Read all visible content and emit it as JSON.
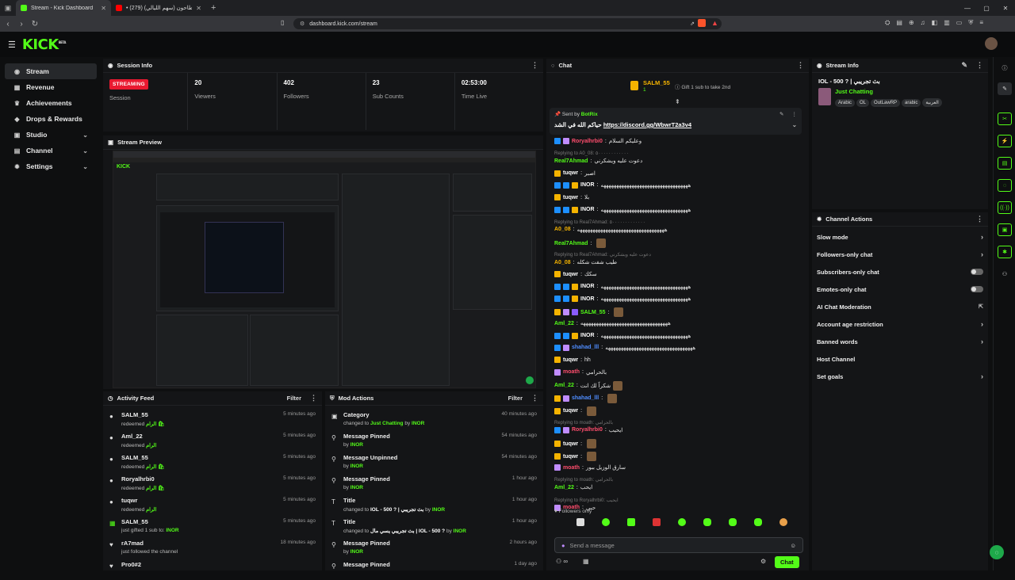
{
  "browser": {
    "tabs": [
      {
        "title": "Stream - Kick Dashboard",
        "favicon_color": "#53fc18"
      },
      {
        "title": "• كان عندنا طاحون (سهم الليالي) (279)",
        "favicon_color": "#ff0000"
      }
    ],
    "url": "dashboard.kick.com/stream"
  },
  "sidenav": [
    {
      "label": "Stream",
      "icon": "broadcast-icon",
      "active": true
    },
    {
      "label": "Revenue",
      "icon": "revenue-icon"
    },
    {
      "label": "Achievements",
      "icon": "trophy-icon"
    },
    {
      "label": "Drops & Rewards",
      "icon": "gift-icon"
    },
    {
      "label": "Studio",
      "icon": "studio-icon",
      "chevron": true
    },
    {
      "label": "Channel",
      "icon": "channel-icon",
      "chevron": true
    },
    {
      "label": "Settings",
      "icon": "gear-icon",
      "chevron": true
    }
  ],
  "session": {
    "title": "Session Info",
    "status": "STREAMING",
    "status_label": "Session",
    "stats": [
      {
        "value": "20",
        "label": "Viewers"
      },
      {
        "value": "402",
        "label": "Followers"
      },
      {
        "value": "23",
        "label": "Sub Counts"
      },
      {
        "value": "02:53:00",
        "label": "Time Live"
      }
    ]
  },
  "preview": {
    "title": "Stream Preview"
  },
  "activity": {
    "title": "Activity Feed",
    "filter": "Filter",
    "items": [
      {
        "name": "SALM_55",
        "desc": "redeemed",
        "extra": "الرام 🛍",
        "time": "5 minutes ago",
        "icon": "points-icon"
      },
      {
        "name": "Aml_22",
        "desc": "redeemed",
        "extra": "الرام",
        "time": "5 minutes ago",
        "icon": "points-icon"
      },
      {
        "name": "SALM_55",
        "desc": "redeemed",
        "extra": "الرام 🛍",
        "time": "5 minutes ago",
        "icon": "points-icon"
      },
      {
        "name": "Roryalhrbi0",
        "desc": "redeemed",
        "extra": "الرام 🛍",
        "time": "5 minutes ago",
        "icon": "points-icon"
      },
      {
        "name": "tuqwr",
        "desc": "redeemed",
        "extra": "الرام",
        "time": "5 minutes ago",
        "icon": "points-icon"
      },
      {
        "name": "SALM_55",
        "desc": "just gifted 1 sub to:",
        "extra": "INOR",
        "time": "5 minutes ago",
        "icon": "gift-sub-icon"
      },
      {
        "name": "rA7mad",
        "desc": "just followed the channel",
        "extra": "",
        "time": "18 minutes ago",
        "icon": "heart-icon"
      },
      {
        "name": "Pro0#2",
        "desc": "",
        "extra": "",
        "time": "",
        "icon": "heart-icon"
      }
    ]
  },
  "mod": {
    "title": "Mod Actions",
    "filter": "Filter",
    "items": [
      {
        "name": "Category",
        "desc": "changed to",
        "extra": "Just Chatting",
        "by": "by",
        "who": "INOR",
        "time": "40 minutes ago",
        "icon": "category-icon"
      },
      {
        "name": "Message Pinned",
        "desc": "by",
        "extra": "",
        "by": "",
        "who": "INOR",
        "time": "54 minutes ago",
        "icon": "pin-icon"
      },
      {
        "name": "Message Unpinned",
        "desc": "by",
        "extra": "",
        "by": "",
        "who": "INOR",
        "time": "54 minutes ago",
        "icon": "pin-icon"
      },
      {
        "name": "Message Pinned",
        "desc": "by",
        "extra": "",
        "by": "",
        "who": "INOR",
        "time": "1 hour ago",
        "icon": "pin-icon"
      },
      {
        "name": "Title",
        "desc": "changed to",
        "extra": "IOL - 500 ? | بث تجريبي",
        "by": "by",
        "who": "INOR",
        "time": "1 hour ago",
        "icon": "title-icon"
      },
      {
        "name": "Title",
        "desc": "changed to",
        "extra": "بث تجريبي يسي مال | IOL - 500 ?",
        "by": "by",
        "who": "INOR",
        "time": "1 hour ago",
        "icon": "title-icon"
      },
      {
        "name": "Message Pinned",
        "desc": "by",
        "extra": "",
        "by": "",
        "who": "INOR",
        "time": "2 hours ago",
        "icon": "pin-icon"
      },
      {
        "name": "Message Pinned",
        "desc": "",
        "extra": "",
        "by": "",
        "who": "",
        "time": "1 day ago",
        "icon": "pin-icon"
      }
    ]
  },
  "chat": {
    "title": "Chat",
    "top_gifter": "SALM_55",
    "top_gifter_sub": "1",
    "gift_hint": "Gift 1 sub to take 2nd",
    "pinned_sent_by": "Sent by",
    "pinned_user": "BotRix",
    "pinned_prefix": "حياكم الله في الشد",
    "pinned_link": "https://discord.gg/WbwrT2a3v4",
    "followers_only": "Followers only",
    "input_placeholder": "Send a message",
    "send": "Chat",
    "messages": [
      {
        "type": "msg",
        "user": "Roryalhrbi0",
        "color": "#ff4d6d",
        "text": "وعليكم السلام",
        "badges": [
          "#1d8fff",
          "#c08cff"
        ]
      },
      {
        "type": "reply",
        "text": "Replying to A0_08: ٥٠٠٠٠٠٠٠٠٠٠٠٠"
      },
      {
        "type": "msg",
        "user": "Real7Ahmad",
        "color": "#53fc18",
        "text": "دعوت عليه ويشكرني",
        "badges": []
      },
      {
        "type": "msg",
        "user": "tuqwr",
        "color": "#ffffff",
        "text": "اصبر",
        "badges": [
          "#f5b300"
        ]
      },
      {
        "type": "msg",
        "user": "INOR",
        "color": "#ffffff",
        "text": "ههههههههههههههههههههههههههههههههههه",
        "badges": [
          "#1d8fff",
          "#1d8fff",
          "#f5b300"
        ]
      },
      {
        "type": "msg",
        "user": "tuqwr",
        "color": "#ffffff",
        "text": "بلا",
        "badges": [
          "#f5b300"
        ]
      },
      {
        "type": "msg",
        "user": "INOR",
        "color": "#ffffff",
        "text": "ههههههههههههههههههههههههههههههههههه",
        "badges": [
          "#1d8fff",
          "#1d8fff",
          "#f5b300"
        ]
      },
      {
        "type": "reply",
        "text": "Replying to Real7Ahmad: ٥٠٠٠٠٠٠٠٠٠٠٠٠٠"
      },
      {
        "type": "msg",
        "user": "A0_08",
        "color": "#f5b300",
        "text": "ههههههههههههههههههههههههههههههههههه",
        "badges": []
      },
      {
        "type": "msg",
        "user": "Real7Ahmad",
        "color": "#53fc18",
        "text": "",
        "emoji": true,
        "badges": []
      },
      {
        "type": "reply",
        "text": "Replying to Real7Ahmad: دعوت عليه ويشكرني"
      },
      {
        "type": "msg",
        "user": "A0_08",
        "color": "#f5b300",
        "text": "طيب شفت شكله",
        "badges": []
      },
      {
        "type": "msg",
        "user": "tuqwr",
        "color": "#ffffff",
        "text": "سكك",
        "badges": [
          "#f5b300"
        ]
      },
      {
        "type": "msg",
        "user": "INOR",
        "color": "#ffffff",
        "text": "ههههههههههههههههههههههههههههههههههه",
        "badges": [
          "#1d8fff",
          "#1d8fff",
          "#f5b300"
        ]
      },
      {
        "type": "msg",
        "user": "INOR",
        "color": "#ffffff",
        "text": "ههههههههههههههههههههههههههههههههههه",
        "badges": [
          "#1d8fff",
          "#1d8fff",
          "#f5b300"
        ]
      },
      {
        "type": "msg",
        "user": "SALM_55",
        "color": "#53fc18",
        "text": "",
        "emoji": true,
        "badges": [
          "#f5b300",
          "#c08cff",
          "#8a5cff"
        ]
      },
      {
        "type": "msg",
        "user": "Aml_22",
        "color": "#53fc18",
        "text": "ههههههههههههههههههههههههههههههههههه",
        "badges": []
      },
      {
        "type": "msg",
        "user": "INOR",
        "color": "#ffffff",
        "text": "ههههههههههههههههههههههههههههههههههه",
        "badges": [
          "#1d8fff",
          "#1d8fff",
          "#f5b300"
        ]
      },
      {
        "type": "msg",
        "user": "shahad_lll",
        "color": "#4f8dff",
        "text": "ههههههههههههههههههههههههههههههههههه",
        "badges": [
          "#1d8fff",
          "#c08cff"
        ]
      },
      {
        "type": "msg",
        "user": "tuqwr",
        "color": "#ffffff",
        "text": "hh",
        "badges": [
          "#f5b300"
        ]
      },
      {
        "type": "msg",
        "user": "moath",
        "color": "#ff4d6d",
        "text": "بالحرامي",
        "badges": [
          "#c08cff"
        ]
      },
      {
        "type": "msg",
        "user": "Aml_22",
        "color": "#53fc18",
        "text": "شكراً لك انت",
        "emoji": true,
        "badges": []
      },
      {
        "type": "msg",
        "user": "shahad_lll",
        "color": "#4f8dff",
        "text": "",
        "emoji": true,
        "badges": [
          "#f5b300",
          "#c08cff"
        ]
      },
      {
        "type": "msg",
        "user": "tuqwr",
        "color": "#ffffff",
        "text": "",
        "emoji": true,
        "badges": [
          "#f5b300"
        ]
      },
      {
        "type": "reply",
        "text": "Replying to moath: بالحرامي"
      },
      {
        "type": "msg",
        "user": "Roryalhrbi0",
        "color": "#ff4d6d",
        "text": "ايحيب",
        "badges": [
          "#1d8fff",
          "#c08cff"
        ]
      },
      {
        "type": "msg",
        "user": "tuqwr",
        "color": "#ffffff",
        "text": "",
        "emoji": true,
        "badges": [
          "#f5b300"
        ]
      },
      {
        "type": "msg",
        "user": "tuqwr",
        "color": "#ffffff",
        "text": "",
        "emoji": true,
        "badges": [
          "#f5b300"
        ]
      },
      {
        "type": "msg",
        "user": "moath",
        "color": "#ff4d6d",
        "text": "سارق الوزيل ببور",
        "badges": [
          "#c08cff"
        ]
      },
      {
        "type": "reply",
        "text": "Replying to moath: بالحرامي"
      },
      {
        "type": "msg",
        "user": "Aml_22",
        "color": "#53fc18",
        "text": "ايحب",
        "badges": []
      },
      {
        "type": "reply",
        "text": "Replying to Roryalhrbi0: ايحيب"
      },
      {
        "type": "msg",
        "user": "moath",
        "color": "#ff4d6d",
        "text": "حبي",
        "badges": [
          "#c08cff"
        ]
      }
    ]
  },
  "stream_info": {
    "title": "Stream Info",
    "stream_title": "IOL - 500 ? | بث تجريبي",
    "category": "Just Chatting",
    "tags": [
      "Arabic",
      "OL",
      "OutLawRP",
      "arabic",
      "العربية"
    ]
  },
  "channel_actions": {
    "title": "Channel Actions",
    "items": [
      {
        "label": "Slow mode",
        "control": "chevron"
      },
      {
        "label": "Followers-only chat",
        "control": "chevron"
      },
      {
        "label": "Subscribers-only chat",
        "control": "toggle"
      },
      {
        "label": "Emotes-only chat",
        "control": "toggle"
      },
      {
        "label": "AI Chat Moderation",
        "control": "external"
      },
      {
        "label": "Account age restriction",
        "control": "chevron"
      },
      {
        "label": "Banned words",
        "control": "chevron"
      },
      {
        "label": "Host Channel",
        "control": "none"
      },
      {
        "label": "Set goals",
        "control": "chevron"
      }
    ]
  },
  "colors": {
    "accent": "#53fc18",
    "live": "#e91930"
  }
}
